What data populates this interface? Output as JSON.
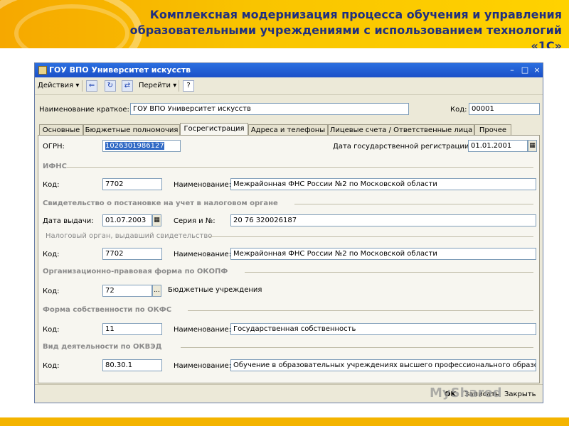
{
  "slide": {
    "title_line1": "Комплексная модернизация процесса обучения и управления",
    "title_line2": "образовательными учреждениями с использованием технологий «1С»"
  },
  "window": {
    "title": "ГОУ ВПО Университет искусств",
    "controls": {
      "minimize": "–",
      "maximize": "□",
      "close": "×"
    }
  },
  "toolbar": {
    "actions_label": "Действия",
    "goto_label": "Перейти",
    "help_label": "?"
  },
  "header": {
    "short_name_label": "Наименование краткое:",
    "short_name_value": "ГОУ ВПО Университет искусств",
    "code_label": "Код:",
    "code_value": "00001"
  },
  "tabs": [
    {
      "label": "Основные"
    },
    {
      "label": "Бюджетные полномочия"
    },
    {
      "label": "Госрегистрация"
    },
    {
      "label": "Адреса и телефоны"
    },
    {
      "label": "Лицевые счета / Ответственные лица"
    },
    {
      "label": "Прочее"
    }
  ],
  "form": {
    "ogrn_label": "ОГРН:",
    "ogrn_value": "1026301986127",
    "reg_date_label": "Дата государственной регистрации:",
    "reg_date_value": "01.01.2001",
    "ifns_section": "ИФНС",
    "ifns_code_label": "Код:",
    "ifns_code_value": "7702",
    "ifns_name_label": "Наименование:",
    "ifns_name_value": "Межрайонная ФНС России №2 по Московской области",
    "cert_section": "Свидетельство о постановке на учет в налоговом органе",
    "issue_date_label": "Дата выдачи:",
    "issue_date_value": "01.07.2003",
    "series_label": "Серия и №:",
    "series_value": "20 76 320026187",
    "issuer_subsection": "Налоговый орган, выдавший свидетельство",
    "issuer_code_label": "Код:",
    "issuer_code_value": "7702",
    "issuer_name_label": "Наименование:",
    "issuer_name_value": "Межрайонная ФНС России №2 по Московской области",
    "okopf_section": "Организационно-правовая форма по ОКОПФ",
    "okopf_code_label": "Код:",
    "okopf_code_value": "72",
    "okopf_desc": "Бюджетные учреждения",
    "okfs_section": "Форма собственности по ОКФС",
    "okfs_code_label": "Код:",
    "okfs_code_value": "11",
    "okfs_name_label": "Наименование:",
    "okfs_name_value": "Государственная собственность",
    "okved_section": "Вид деятельности по ОКВЭД",
    "okved_code_label": "Код:",
    "okved_code_value": "80.30.1",
    "okved_name_label": "Наименование:",
    "okved_name_value": "Обучение в образовательных  учреждениях высшего профессионального образова"
  },
  "footer": {
    "ok_label": "OK",
    "save_label": "Записать",
    "close_label": "Закрыть"
  },
  "watermark": "MyShared"
}
